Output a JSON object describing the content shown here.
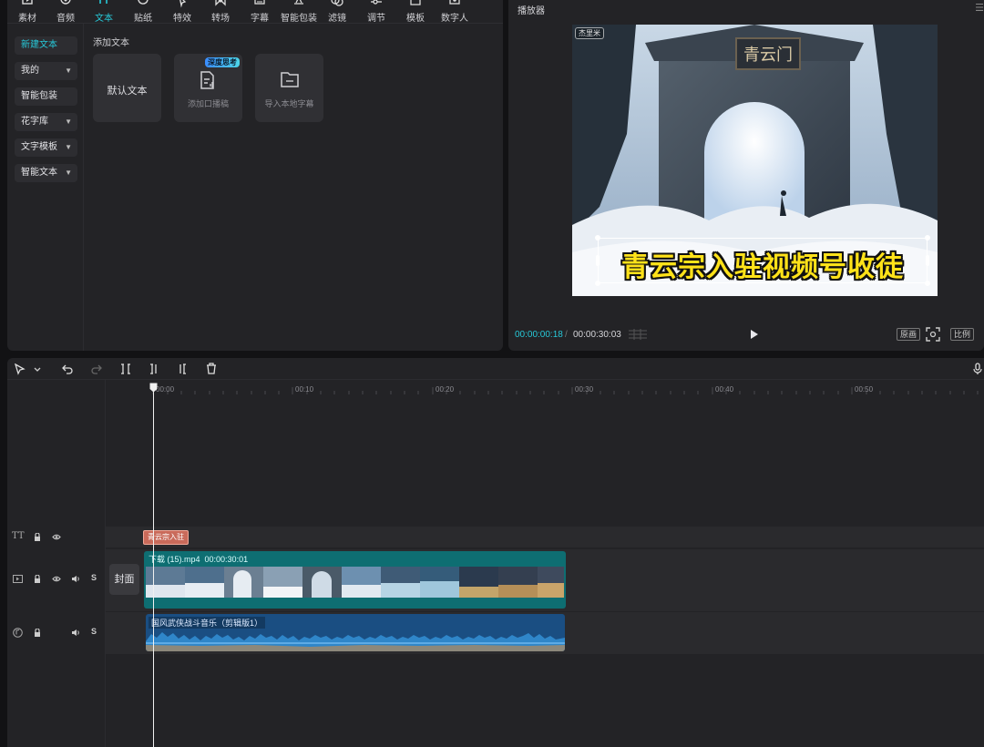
{
  "toolbar": {
    "items": [
      {
        "label": "素材",
        "icon": "media-icon"
      },
      {
        "label": "音频",
        "icon": "audio-icon"
      },
      {
        "label": "文本",
        "icon": "text-icon",
        "active": true
      },
      {
        "label": "贴纸",
        "icon": "sticker-icon"
      },
      {
        "label": "特效",
        "icon": "effects-icon"
      },
      {
        "label": "转场",
        "icon": "transition-icon"
      },
      {
        "label": "字幕",
        "icon": "caption-icon"
      },
      {
        "label": "智能包装",
        "icon": "smart-pack-icon"
      },
      {
        "label": "滤镜",
        "icon": "filter-icon"
      },
      {
        "label": "调节",
        "icon": "adjust-icon"
      },
      {
        "label": "模板",
        "icon": "template-icon"
      },
      {
        "label": "数字人",
        "icon": "digital-human-icon"
      }
    ]
  },
  "side_nav": {
    "items": [
      {
        "label": "新建文本",
        "active": true,
        "has_dropdown": false
      },
      {
        "label": "我的",
        "has_dropdown": true
      },
      {
        "label": "智能包装",
        "has_dropdown": false
      },
      {
        "label": "花字库",
        "has_dropdown": true
      },
      {
        "label": "文字模板",
        "has_dropdown": true
      },
      {
        "label": "智能文本",
        "has_dropdown": true
      }
    ]
  },
  "content": {
    "section_title": "添加文本",
    "cards": [
      {
        "label": "默认文本"
      },
      {
        "label": "添加口播稿",
        "badge": "深度思考",
        "icon": "script-doc-icon"
      },
      {
        "label": "导入本地字幕",
        "icon": "folder-icon"
      }
    ]
  },
  "player": {
    "title": "播放器",
    "subtitle": "青云宗入驻视频号收徒",
    "gate_plaque": "青云门",
    "watermark": "杰里米",
    "time_current": "00:00:00:18",
    "time_separator": "/",
    "time_total": "00:00:30:03",
    "buttons": {
      "original": "原画",
      "ratio": "比例"
    }
  },
  "timeline": {
    "ruler": [
      "00:00",
      "00:10",
      "00:20",
      "00:30",
      "00:40",
      "00:50"
    ],
    "text_clip_label": "青云宗入驻",
    "cover_label": "封面",
    "video_clip": {
      "name": "下载 (15).mp4",
      "duration": "00:00:30:01"
    },
    "audio_clip": {
      "name": "国风武侠战斗音乐（剪辑版1）"
    },
    "solo_label": "S",
    "text_track_label": "TT"
  },
  "colors": {
    "accent": "#27c8d8",
    "video_clip": "#0e6e72",
    "audio_clip": "#1a4e82",
    "text_clip": "#c96a5a",
    "subtitle": "#ffe219"
  }
}
